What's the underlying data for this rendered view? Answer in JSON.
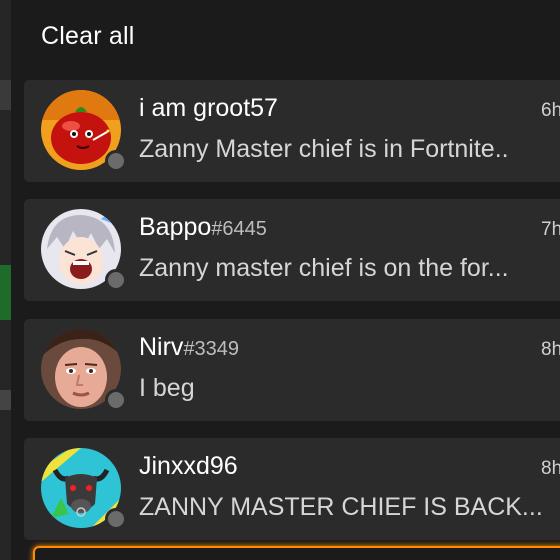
{
  "panel": {
    "clear_all_label": "Clear all"
  },
  "notifications": [
    {
      "name": "i am groot57",
      "tag": "",
      "message": "Zanny Master chief is in Fortnite..",
      "time": "6h",
      "presence": "offline",
      "avatar": "tomato-character-icon"
    },
    {
      "name": "Bappo",
      "tag": "#6445",
      "message": "Zanny master chief is on the for...",
      "time": "7h",
      "presence": "offline",
      "avatar": "anime-character-icon"
    },
    {
      "name": "Nirv",
      "tag": "#3349",
      "message": "I beg",
      "time": "8h",
      "presence": "offline",
      "avatar": "face-photo-icon"
    },
    {
      "name": "Jinxxd96",
      "tag": "",
      "message": "ZANNY MASTER CHIEF IS BACK...",
      "time": "8h",
      "presence": "offline",
      "avatar": "bull-logo-icon"
    }
  ],
  "colors": {
    "background": "#1b1b1b",
    "card": "#2b2b2b",
    "presence_offline": "#6b6b6b",
    "focus_accent": "#ff8c00"
  }
}
